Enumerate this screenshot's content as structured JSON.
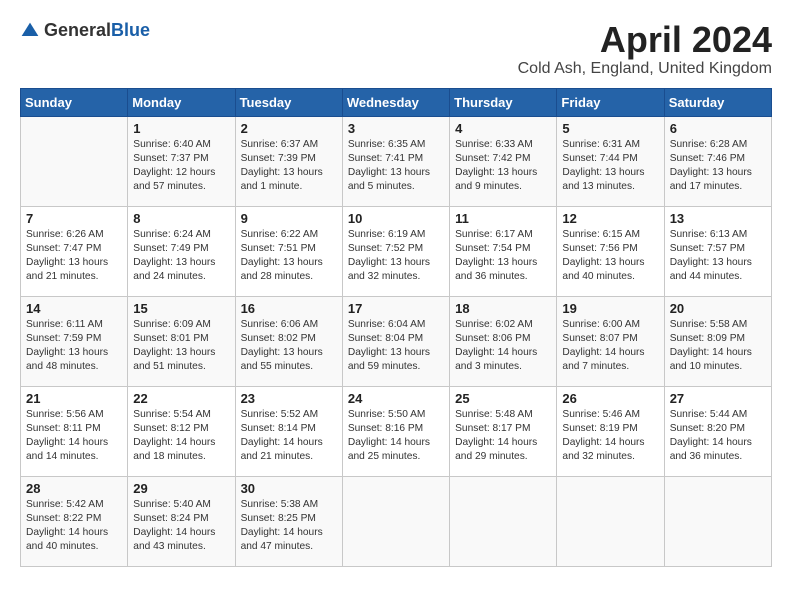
{
  "header": {
    "logo_general": "General",
    "logo_blue": "Blue",
    "month": "April 2024",
    "location": "Cold Ash, England, United Kingdom"
  },
  "weekdays": [
    "Sunday",
    "Monday",
    "Tuesday",
    "Wednesday",
    "Thursday",
    "Friday",
    "Saturday"
  ],
  "weeks": [
    [
      {
        "day": "",
        "text": ""
      },
      {
        "day": "1",
        "text": "Sunrise: 6:40 AM\nSunset: 7:37 PM\nDaylight: 12 hours\nand 57 minutes."
      },
      {
        "day": "2",
        "text": "Sunrise: 6:37 AM\nSunset: 7:39 PM\nDaylight: 13 hours\nand 1 minute."
      },
      {
        "day": "3",
        "text": "Sunrise: 6:35 AM\nSunset: 7:41 PM\nDaylight: 13 hours\nand 5 minutes."
      },
      {
        "day": "4",
        "text": "Sunrise: 6:33 AM\nSunset: 7:42 PM\nDaylight: 13 hours\nand 9 minutes."
      },
      {
        "day": "5",
        "text": "Sunrise: 6:31 AM\nSunset: 7:44 PM\nDaylight: 13 hours\nand 13 minutes."
      },
      {
        "day": "6",
        "text": "Sunrise: 6:28 AM\nSunset: 7:46 PM\nDaylight: 13 hours\nand 17 minutes."
      }
    ],
    [
      {
        "day": "7",
        "text": "Sunrise: 6:26 AM\nSunset: 7:47 PM\nDaylight: 13 hours\nand 21 minutes."
      },
      {
        "day": "8",
        "text": "Sunrise: 6:24 AM\nSunset: 7:49 PM\nDaylight: 13 hours\nand 24 minutes."
      },
      {
        "day": "9",
        "text": "Sunrise: 6:22 AM\nSunset: 7:51 PM\nDaylight: 13 hours\nand 28 minutes."
      },
      {
        "day": "10",
        "text": "Sunrise: 6:19 AM\nSunset: 7:52 PM\nDaylight: 13 hours\nand 32 minutes."
      },
      {
        "day": "11",
        "text": "Sunrise: 6:17 AM\nSunset: 7:54 PM\nDaylight: 13 hours\nand 36 minutes."
      },
      {
        "day": "12",
        "text": "Sunrise: 6:15 AM\nSunset: 7:56 PM\nDaylight: 13 hours\nand 40 minutes."
      },
      {
        "day": "13",
        "text": "Sunrise: 6:13 AM\nSunset: 7:57 PM\nDaylight: 13 hours\nand 44 minutes."
      }
    ],
    [
      {
        "day": "14",
        "text": "Sunrise: 6:11 AM\nSunset: 7:59 PM\nDaylight: 13 hours\nand 48 minutes."
      },
      {
        "day": "15",
        "text": "Sunrise: 6:09 AM\nSunset: 8:01 PM\nDaylight: 13 hours\nand 51 minutes."
      },
      {
        "day": "16",
        "text": "Sunrise: 6:06 AM\nSunset: 8:02 PM\nDaylight: 13 hours\nand 55 minutes."
      },
      {
        "day": "17",
        "text": "Sunrise: 6:04 AM\nSunset: 8:04 PM\nDaylight: 13 hours\nand 59 minutes."
      },
      {
        "day": "18",
        "text": "Sunrise: 6:02 AM\nSunset: 8:06 PM\nDaylight: 14 hours\nand 3 minutes."
      },
      {
        "day": "19",
        "text": "Sunrise: 6:00 AM\nSunset: 8:07 PM\nDaylight: 14 hours\nand 7 minutes."
      },
      {
        "day": "20",
        "text": "Sunrise: 5:58 AM\nSunset: 8:09 PM\nDaylight: 14 hours\nand 10 minutes."
      }
    ],
    [
      {
        "day": "21",
        "text": "Sunrise: 5:56 AM\nSunset: 8:11 PM\nDaylight: 14 hours\nand 14 minutes."
      },
      {
        "day": "22",
        "text": "Sunrise: 5:54 AM\nSunset: 8:12 PM\nDaylight: 14 hours\nand 18 minutes."
      },
      {
        "day": "23",
        "text": "Sunrise: 5:52 AM\nSunset: 8:14 PM\nDaylight: 14 hours\nand 21 minutes."
      },
      {
        "day": "24",
        "text": "Sunrise: 5:50 AM\nSunset: 8:16 PM\nDaylight: 14 hours\nand 25 minutes."
      },
      {
        "day": "25",
        "text": "Sunrise: 5:48 AM\nSunset: 8:17 PM\nDaylight: 14 hours\nand 29 minutes."
      },
      {
        "day": "26",
        "text": "Sunrise: 5:46 AM\nSunset: 8:19 PM\nDaylight: 14 hours\nand 32 minutes."
      },
      {
        "day": "27",
        "text": "Sunrise: 5:44 AM\nSunset: 8:20 PM\nDaylight: 14 hours\nand 36 minutes."
      }
    ],
    [
      {
        "day": "28",
        "text": "Sunrise: 5:42 AM\nSunset: 8:22 PM\nDaylight: 14 hours\nand 40 minutes."
      },
      {
        "day": "29",
        "text": "Sunrise: 5:40 AM\nSunset: 8:24 PM\nDaylight: 14 hours\nand 43 minutes."
      },
      {
        "day": "30",
        "text": "Sunrise: 5:38 AM\nSunset: 8:25 PM\nDaylight: 14 hours\nand 47 minutes."
      },
      {
        "day": "",
        "text": ""
      },
      {
        "day": "",
        "text": ""
      },
      {
        "day": "",
        "text": ""
      },
      {
        "day": "",
        "text": ""
      }
    ]
  ]
}
